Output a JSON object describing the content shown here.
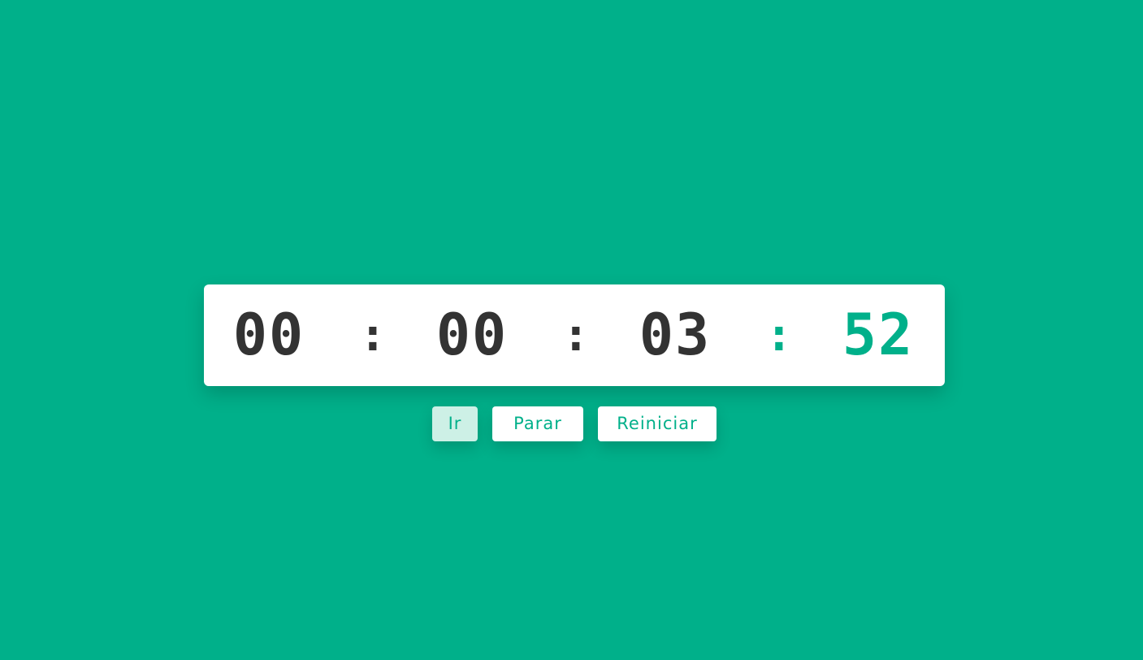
{
  "timer": {
    "hours": "00",
    "minutes": "00",
    "seconds": "03",
    "centiseconds": "52",
    "separator": ":"
  },
  "controls": {
    "go_label": "Ir",
    "stop_label": "Parar",
    "reset_label": "Reiniciar"
  },
  "colors": {
    "background": "#00b08a",
    "card": "#ffffff",
    "digits": "#333333",
    "accent": "#00b08a",
    "active_button": "#cdf0e6"
  }
}
